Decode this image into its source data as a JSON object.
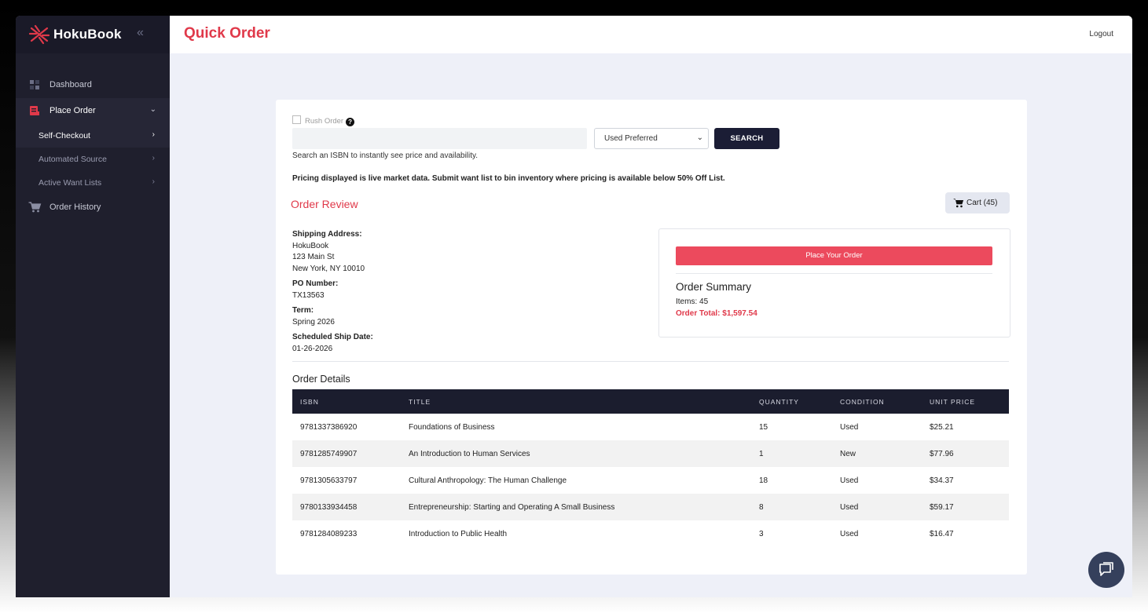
{
  "brand": {
    "name": "HokuBook"
  },
  "colors": {
    "accent": "#e0394a",
    "sidebar": "#1f1f2d",
    "dark": "#1b1d35",
    "place_btn": "#ec4a5d"
  },
  "sidebar": {
    "items": [
      {
        "label": "Dashboard",
        "icon": "dashboard-icon"
      },
      {
        "label": "Place Order",
        "icon": "order-form-icon"
      },
      {
        "label": "Order History",
        "icon": "cart-icon"
      }
    ],
    "subitems": [
      {
        "label": "Self-Checkout"
      },
      {
        "label": "Automated Source"
      },
      {
        "label": "Active Want Lists"
      }
    ]
  },
  "header": {
    "title": "Quick Order",
    "logout": "Logout"
  },
  "search": {
    "rush_label": "Rush Order",
    "isbn_value": "",
    "condition_selected": "Used Preferred",
    "button": "SEARCH",
    "hint": "Search an ISBN to instantly see price and availability.",
    "pricing_note": "Pricing displayed is live market data. Submit want list to bin inventory where pricing is available below 50% Off List."
  },
  "review": {
    "title": "Order Review",
    "cart_label": "Cart (45)",
    "shipping_label": "Shipping Address:",
    "shipping_lines": [
      "HokuBook",
      "123 Main St",
      "New York, NY 10010"
    ],
    "po_label": "PO Number:",
    "po_value": "TX13563",
    "term_label": "Term:",
    "term_value": "Spring 2026",
    "ship_date_label": "Scheduled Ship Date:",
    "ship_date_value": "01-26-2026"
  },
  "summary": {
    "place_button": "Place Your Order",
    "title": "Order Summary",
    "items": "Items: 45",
    "total": "Order Total: $1,597.54"
  },
  "details": {
    "title": "Order Details",
    "columns": [
      "ISBN",
      "TITLE",
      "QUANTITY",
      "CONDITION",
      "UNIT PRICE"
    ],
    "rows": [
      [
        "9781337386920",
        "Foundations of Business",
        "15",
        "Used",
        "$25.21"
      ],
      [
        "9781285749907",
        "An Introduction to Human Services",
        "1",
        "New",
        "$77.96"
      ],
      [
        "9781305633797",
        "Cultural Anthropology: The Human Challenge",
        "18",
        "Used",
        "$34.37"
      ],
      [
        "9780133934458",
        "Entrepreneurship: Starting and Operating A Small Business",
        "8",
        "Used",
        "$59.17"
      ],
      [
        "9781284089233",
        "Introduction to Public Health",
        "3",
        "Used",
        "$16.47"
      ]
    ]
  }
}
